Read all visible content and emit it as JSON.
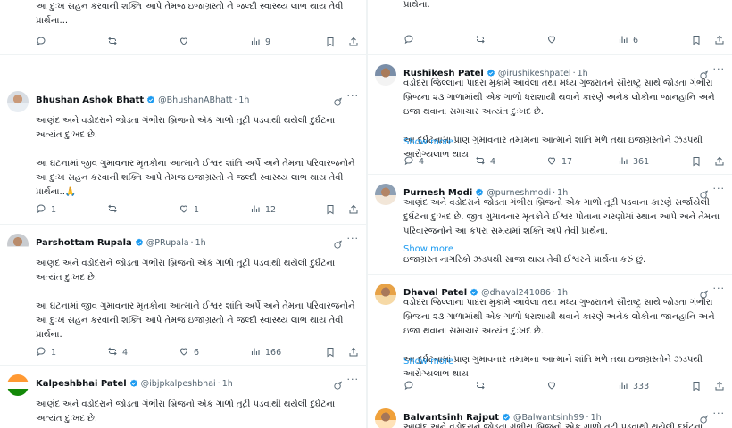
{
  "left": {
    "t0": {
      "body": [
        "આ ઘટનામાં જીવ ગુમાવનાર મૃતકોના આત્માને ઈશ્વર શાંતિ અર્પે અને તેમના પરિવારજનોને આ દુઃખ સહન કરવાની શક્તિ આપે તેમજ ઇજાગ્રસ્તો ને જલ્દી સ્વાસ્થ્ય લાભ થાય તેવી પ્રાર્થના..."
      ],
      "reply": "",
      "retweet": "",
      "like": "",
      "views": "9"
    },
    "t1": {
      "name": "Bhushan Ashok Bhatt",
      "handle": "@BhushanABhatt",
      "time": "1h",
      "body": [
        "આણંદ અને વડોદરાને જોડતા ગંભીરા બ્રિજનો એક ગાળો તૂટી પડવાથી થયેલી દુર્ઘટના અત્યંત દુઃખદ છે.",
        "આ ઘટનામાં જીવ ગુમાવનાર મૃતકોના આત્માને ઈશ્વર શાંતિ અર્પે અને તેમના પરિવારજનોને આ દુઃખ સહન કરવાની શક્તિ આપે તેમજ ઇજાગ્રસ્તો ને જલ્દી સ્વાસ્થ્ય લાભ થાય તેવી પ્રાર્થના..🙏"
      ],
      "reply": "1",
      "retweet": "",
      "like": "1",
      "views": "12"
    },
    "t2": {
      "name": "Parshottam Rupala",
      "handle": "@PRupala",
      "time": "1h",
      "body": [
        "આણંદ અને વડોદરાને જોડતા ગંભીરા બ્રિજનો એક ગાળો તૂટી પડવાથી થયેલી દુર્ઘટના અત્યંત દુઃખદ છે.",
        "આ ઘટનામાં જીવ ગુમાવનાર મૃતકોના આત્માને ઈશ્વર શાંતિ અર્પે અને તેમના પરિવારજનોને આ દુઃખ સહન કરવાની શક્તિ આપે તેમજ ઇજાગ્રસ્તો ને જલ્દી સ્વાસ્થ્ય લાભ થાય તેવી પ્રાર્થના."
      ],
      "reply": "1",
      "retweet": "4",
      "like": "6",
      "views": "166"
    },
    "t3": {
      "name": "Kalpeshbhai Patel",
      "handle": "@ibjpkalpeshbhai",
      "time": "1h",
      "body": [
        "આણંદ અને વડોદરાને જોડતા ગંભીરા બ્રિજનો એક ગાળો તૂટી પડવાથી થયેલી દુર્ઘટના અત્યંત દુઃખદ છે."
      ]
    }
  },
  "right": {
    "t0": {
      "body": [
        "આ ઘટનામાં જીવ ગુમાવનાર મૃતકોના આત્માને ઈશ્વર શાંતિ અર્પે અને તેમના પરિવારજનોને આ દુઃખ સહન કરવાની શક્તિ આપે તેમજ ઇજાગ્રસ્તો ને જલ્દી સ્વાસ્થ્ય લાભ થાય તેવી પ્રાર્થના."
      ],
      "reply": "",
      "retweet": "",
      "like": "",
      "views": "6"
    },
    "t1": {
      "name": "Rushikesh Patel",
      "handle": "@irushikeshpatel",
      "time": "1h",
      "body": [
        "વડોદરા જિલ્લાના પાદરા મુકામે આવેલા તથા મધ્ય ગુજરાતને સૌરાષ્ટ્ર સાથે જોડતા ગંભીરા બ્રિજના ૨૩ ગાળામાંથી એક ગાળો ધરાશાયી થવાને કારણે અનેક લોકોના જાનહાનિ અને ઇજા થવાના સમાચાર અત્યંત દુઃખદ છે.",
        "આ દુર્ઘટનામાં પ્રાણ ગુમાવનાર તમામના આત્માને શાંતિ મળે તથા ઇજાગ્રસ્તોને ઝડપથી આરોગ્યલાભ થાય"
      ],
      "show_more": "Show more",
      "reply": "4",
      "retweet": "4",
      "like": "17",
      "views": "361"
    },
    "t2": {
      "name": "Purnesh Modi",
      "handle": "@purneshmodi",
      "time": "1h",
      "body": [
        "આણંદ અને વડોદરાને જોડતા ગંભીરા બ્રિજનો એક ગાળો તૂટી પડવાના કારણે સર્જાયેલી દુર્ઘટના દુઃખદ છે. જીવ ગુમાવનાર મૃતકોને ઈશ્વર પોતાના ચરણોમાં સ્થાન આપે અને તેમના પરિવારજનોને આ કપરા સમયમાં શક્તિ અર્પે તેવી પ્રાર્થના.",
        "ઇજાગ્રસ્ત નાગરિકો ઝડપથી સાજા થાય તેવી ઈશ્વરને પ્રાર્થના કરું છું."
      ],
      "show_more": "Show more"
    },
    "t3": {
      "name": "Dhaval Patel",
      "handle": "@dhaval241086",
      "time": "1h",
      "body": [
        "વડોદરા જિલ્લાના પાદરા મુકામે આવેલા તથા મધ્ય ગુજરાતને સૌરાષ્ટ્ર સાથે જોડતા ગંભીરા બ્રિજના ૨૩ ગાળામાંથી એક ગાળો ધરાશાયી થવાને કારણે અનેક લોકોના જાનહાનિ અને ઇજા થવાના સમાચાર અત્યંત દુઃખદ છે.",
        "આ દુર્ઘટનામાં પ્રાણ ગુમાવનાર તમામના આત્માને શાંતિ મળે તથા ઇજાગ્રસ્તોને ઝડપથી આરોગ્યલાભ થાય"
      ],
      "show_more": "Show more",
      "reply": "",
      "retweet": "",
      "like": "",
      "views": "333"
    },
    "t4": {
      "name": "Balvantsinh Rajput",
      "handle": "@Balwantsinh99",
      "time": "1h",
      "body": [
        "આણંદ અને વડોદરાને જોડતા ગંભીરા બ્રિજનો એક ગાળો તૂટી પડવાથી થયેલી દુર્ઘટના"
      ]
    }
  },
  "colors": {
    "link": "#1d9bf0",
    "muted": "#536471",
    "verified": "#1d9bf0",
    "text": "#0f1419"
  },
  "icons": [
    "reply-icon",
    "retweet-icon",
    "like-icon",
    "views-icon",
    "bookmark-icon",
    "share-icon",
    "grok-icon",
    "more-icon",
    "verified-badge-icon"
  ]
}
